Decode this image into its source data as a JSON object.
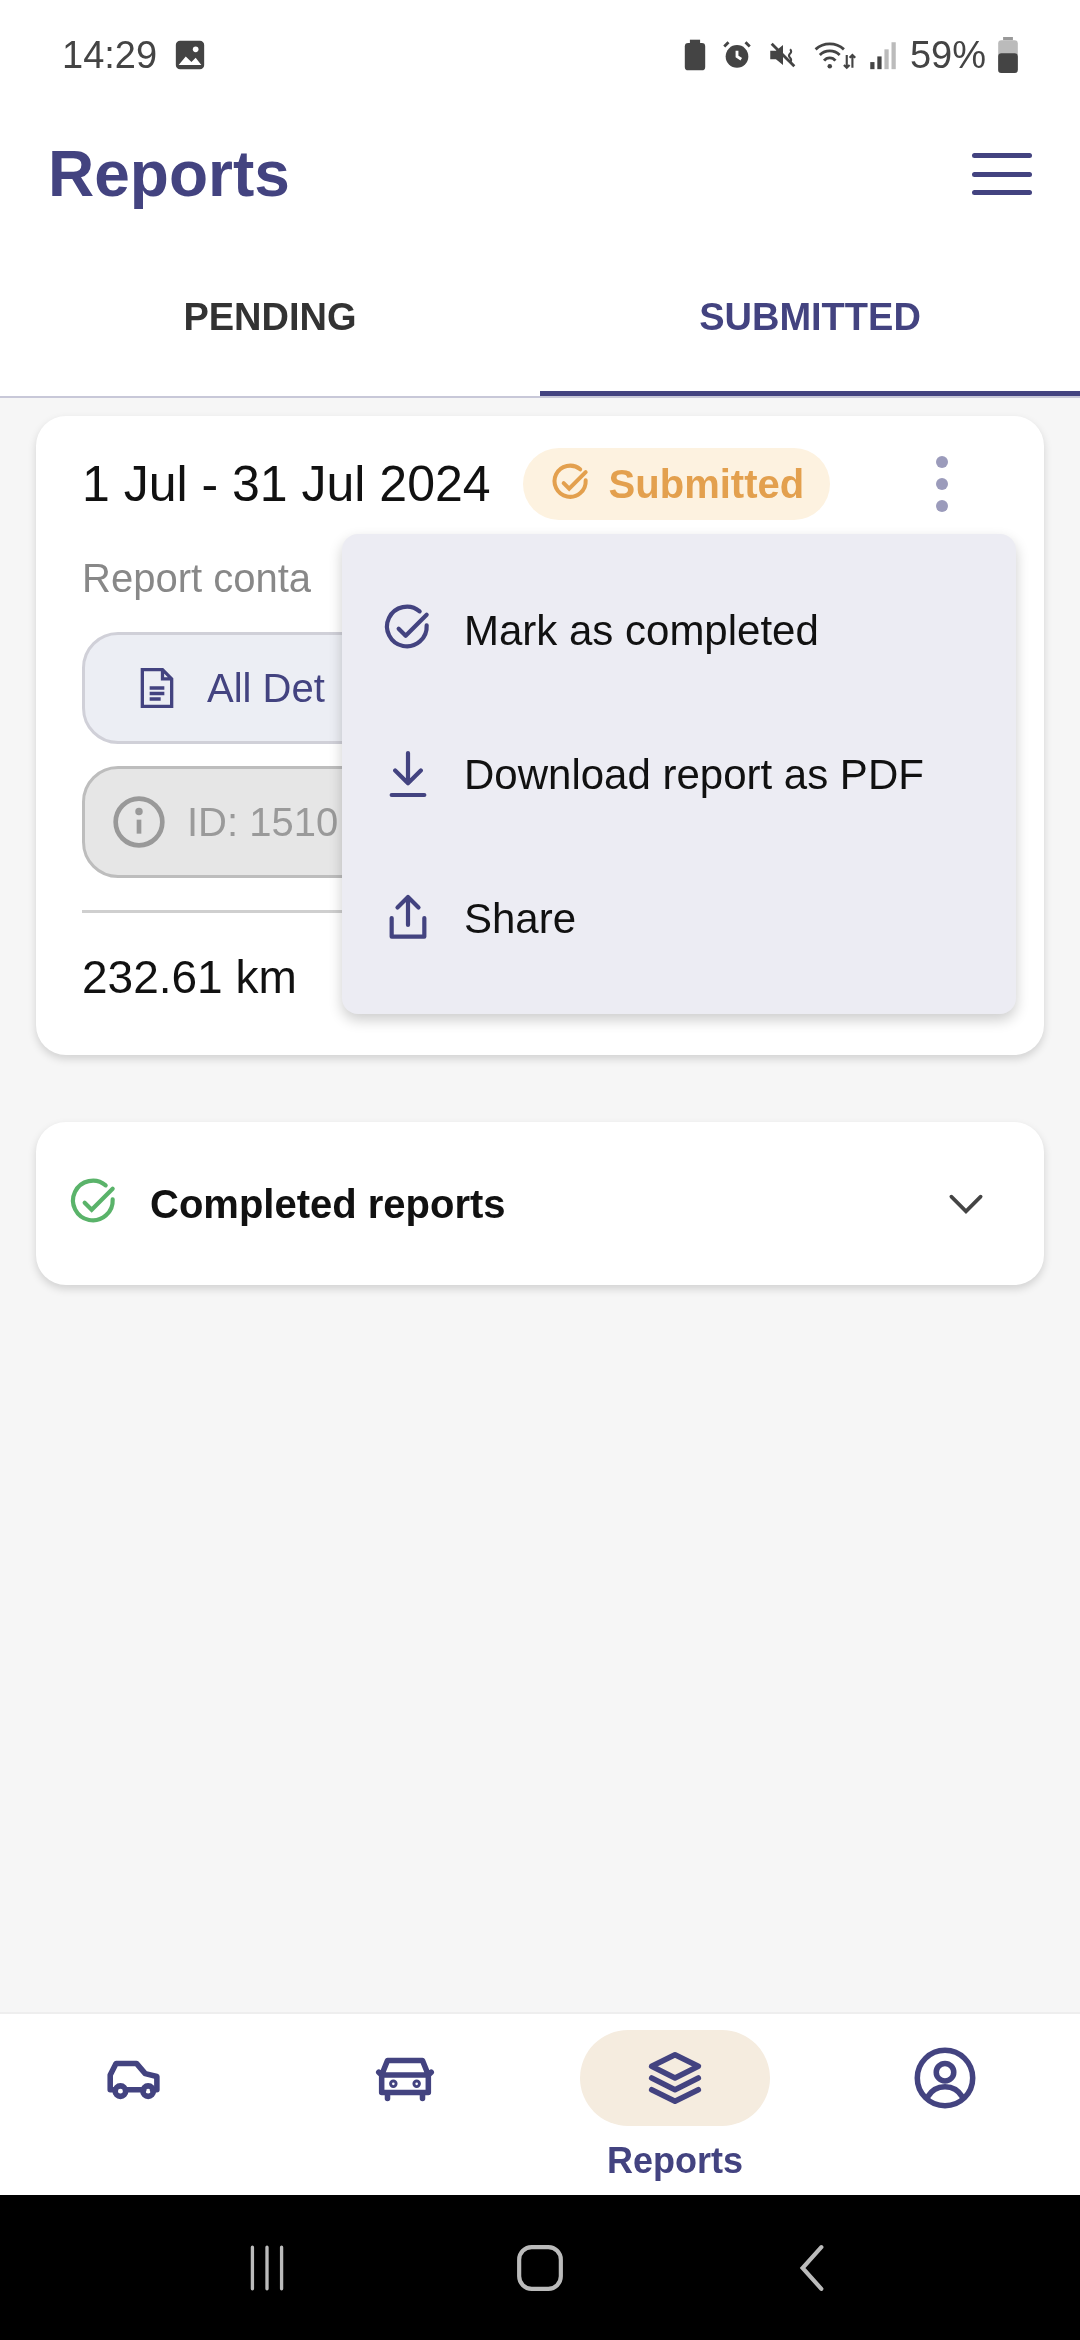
{
  "status_bar": {
    "time": "14:29",
    "battery": "59%"
  },
  "header": {
    "title": "Reports"
  },
  "tabs": [
    {
      "label": "PENDING",
      "selected": false
    },
    {
      "label": "SUBMITTED",
      "selected": true
    }
  ],
  "report_card": {
    "period": "1 Jul - 31 Jul 2024",
    "status": "Submitted",
    "description": "Report conta",
    "details_button": "All Det",
    "id_field": "ID: 1510",
    "distance": "232.61 km"
  },
  "menu": {
    "items": [
      {
        "kind": "complete",
        "label": "Mark as completed"
      },
      {
        "kind": "download",
        "label": "Download report as PDF"
      },
      {
        "kind": "share",
        "label": "Share"
      }
    ]
  },
  "completed_section": {
    "title": "Completed reports",
    "expanded": false
  },
  "bottom_nav": [
    {
      "kind": "suv",
      "selected": false
    },
    {
      "kind": "car",
      "selected": false
    },
    {
      "kind": "reports",
      "label": "Reports",
      "selected": true
    },
    {
      "kind": "profile",
      "selected": false
    }
  ]
}
